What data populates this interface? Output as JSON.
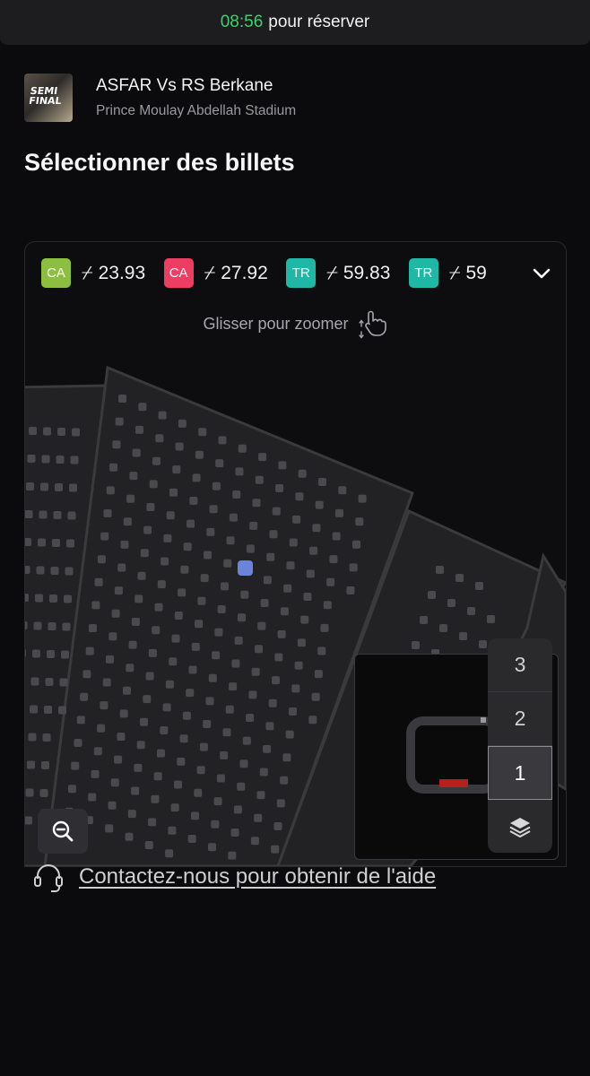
{
  "timer": {
    "time": "08:56",
    "label": "pour réserver"
  },
  "event": {
    "thumb_text": "SEMI FINAL",
    "title": "ASFAR Vs RS Berkane",
    "venue": "Prince Moulay Abdellah Stadium"
  },
  "section_title": "Sélectionner des billets",
  "prices": [
    {
      "badge": "CA",
      "color": "#8cbf3f",
      "currency": "⌿",
      "amount": "23.93"
    },
    {
      "badge": "CA",
      "color": "#ee3d62",
      "currency": "⌿",
      "amount": "27.92"
    },
    {
      "badge": "TR",
      "color": "#1fb8a6",
      "currency": "⌿",
      "amount": "59.83"
    },
    {
      "badge": "TR",
      "color": "#1fb8a6",
      "currency": "⌿",
      "amount": "59"
    }
  ],
  "zoom_hint": "Glisser pour zoomer",
  "levels": [
    "3",
    "2",
    "1"
  ],
  "active_level": "1",
  "help": "Contactez-nous pour obtenir de l'aide",
  "colors": {
    "timer_green": "#3ecf6e",
    "selected_seat": "#6b84d9",
    "seat": "#4a4a4e",
    "section_fill": "#222224"
  }
}
